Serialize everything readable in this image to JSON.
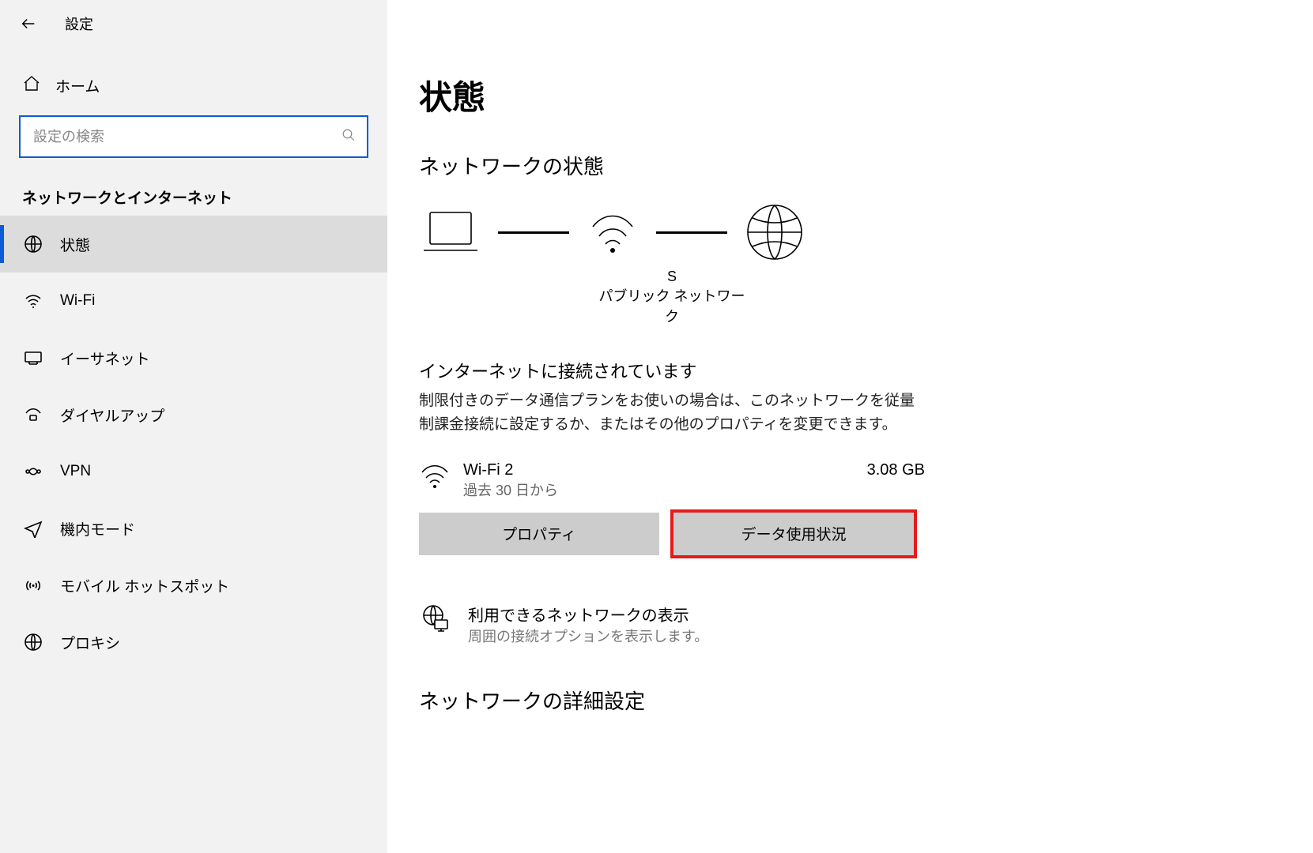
{
  "app_title": "設定",
  "sidebar": {
    "home_label": "ホーム",
    "search_placeholder": "設定の検索",
    "category_label": "ネットワークとインターネット",
    "items": [
      {
        "label": "状態"
      },
      {
        "label": "Wi-Fi"
      },
      {
        "label": "イーサネット"
      },
      {
        "label": "ダイヤルアップ"
      },
      {
        "label": "VPN"
      },
      {
        "label": "機内モード"
      },
      {
        "label": "モバイル ホットスポット"
      },
      {
        "label": "プロキシ"
      }
    ]
  },
  "main": {
    "page_title": "状態",
    "network_status_title": "ネットワークの状態",
    "diagram": {
      "ssid": "S",
      "network_type": "パブリック ネットワーク"
    },
    "connected_title": "インターネットに接続されています",
    "connected_desc": "制限付きのデータ通信プランをお使いの場合は、このネットワークを従量制課金接続に設定するか、またはその他のプロパティを変更できます。",
    "wifi": {
      "name": "Wi-Fi 2",
      "subtitle": "過去 30 日から",
      "usage": "3.08 GB"
    },
    "buttons": {
      "properties": "プロパティ",
      "data_usage": "データ使用状況"
    },
    "available_networks": {
      "title": "利用できるネットワークの表示",
      "subtitle": "周囲の接続オプションを表示します。"
    },
    "advanced_title": "ネットワークの詳細設定"
  }
}
